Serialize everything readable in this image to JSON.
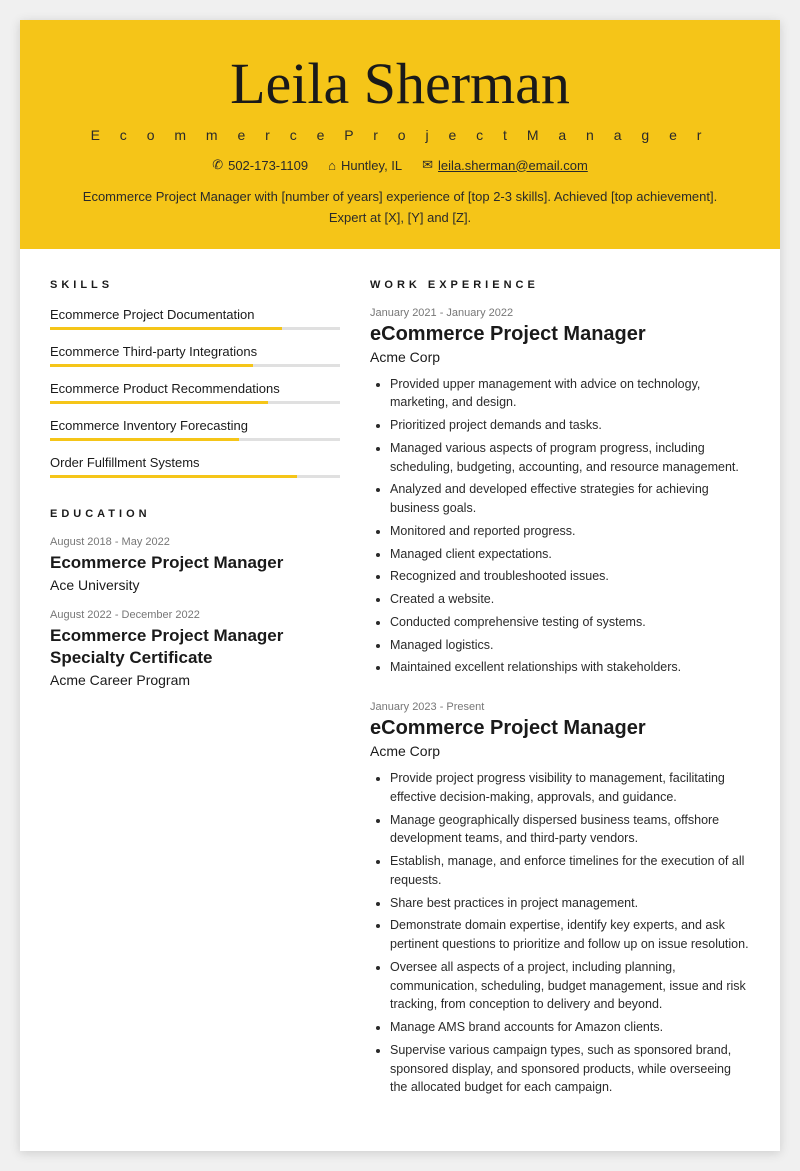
{
  "header": {
    "name": "Leila Sherman",
    "title": "E c o m m e r c e   P r o j e c t   M a n a g e r",
    "phone": "502-173-1109",
    "location": "Huntley, IL",
    "email": "leila.sherman@email.com",
    "summary": "Ecommerce Project Manager with [number of years] experience of [top 2-3 skills]. Achieved [top achievement]. Expert at [X], [Y] and [Z]."
  },
  "skills": {
    "section_label": "SKILLS",
    "items": [
      {
        "name": "Ecommerce Project Documentation",
        "pct": 80
      },
      {
        "name": "Ecommerce Third-party Integrations",
        "pct": 70
      },
      {
        "name": "Ecommerce Product Recommendations",
        "pct": 75
      },
      {
        "name": "Ecommerce Inventory Forecasting",
        "pct": 65
      },
      {
        "name": "Order Fulfillment Systems",
        "pct": 85
      }
    ]
  },
  "education": {
    "section_label": "EDUCATION",
    "items": [
      {
        "date": "August 2018 - May 2022",
        "degree": "Ecommerce Project Manager",
        "school": "Ace University"
      },
      {
        "date": "August 2022 - December 2022",
        "degree": "Ecommerce Project Manager Specialty Certificate",
        "school": "Acme Career Program"
      }
    ]
  },
  "work_experience": {
    "section_label": "WORK EXPERIENCE",
    "items": [
      {
        "date": "January 2021 - January 2022",
        "title": "eCommerce Project Manager",
        "company": "Acme Corp",
        "bullets": [
          "Provided upper management with advice on technology, marketing, and design.",
          "Prioritized project demands and tasks.",
          "Managed various aspects of program progress, including scheduling, budgeting, accounting, and resource management.",
          "Analyzed and developed effective strategies for achieving business goals.",
          "Monitored and reported progress.",
          "Managed client expectations.",
          "Recognized and troubleshooted issues.",
          "Created a website.",
          "Conducted comprehensive testing of systems.",
          "Managed logistics.",
          "Maintained excellent relationships with stakeholders."
        ]
      },
      {
        "date": "January 2023 - Present",
        "title": "eCommerce Project Manager",
        "company": "Acme Corp",
        "bullets": [
          "Provide project progress visibility to management, facilitating effective decision-making, approvals, and guidance.",
          "Manage geographically dispersed business teams, offshore development teams, and third-party vendors.",
          "Establish, manage, and enforce timelines for the execution of all requests.",
          "Share best practices in project management.",
          "Demonstrate domain expertise, identify key experts, and ask pertinent questions to prioritize and follow up on issue resolution.",
          "Oversee all aspects of a project, including planning, communication, scheduling, budget management, issue and risk tracking, from conception to delivery and beyond.",
          "Manage AMS brand accounts for Amazon clients.",
          "Supervise various campaign types, such as sponsored brand, sponsored display, and sponsored products, while overseeing the allocated budget for each campaign."
        ]
      }
    ]
  }
}
